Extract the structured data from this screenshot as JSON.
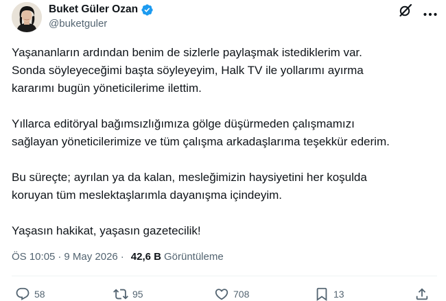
{
  "author": {
    "display_name": "Buket Güler Ozan",
    "handle": "@buketguler"
  },
  "icons": {
    "avatar": "avatar",
    "verified": "verified-badge-icon",
    "grok": "grok-icon",
    "more": "more-icon",
    "reply": "reply-icon",
    "retweet": "retweet-icon",
    "like": "like-icon",
    "bookmark": "bookmark-icon",
    "share": "share-icon"
  },
  "colors": {
    "verified": "#1d9bf0",
    "text": "#0f1419",
    "secondary": "#536471",
    "divider": "#eff3f4"
  },
  "tweet": {
    "paragraphs": [
      "Yaşananların ardından benim de sizlerle paylaşmak istediklerim var.\nSonda söyleyeceğimi başta söyleyeyim, Halk TV ile yollarımı ayırma\nkararımı bugün yöneticilerime ilettim.",
      "Yıllarca editöryal bağımsızlığımıza gölge düşürmeden çalışmamızı\nsağlayan yöneticilerimize ve tüm çalışma arkadaşlarıma teşekkür ederim.",
      "Bu süreçte; ayrılan ya da kalan, mesleğimizin haysiyetini her koşulda\nkoruyan tüm meslektaşlarımla dayanışma içindeyim.",
      "Yaşasın hakikat, yaşasın gazetecilik!"
    ]
  },
  "meta": {
    "time": "ÖS 10:05",
    "separator": "·",
    "date": "9 May 2026",
    "views_count": "42,6 B",
    "views_label": "Görüntüleme"
  },
  "actions": {
    "replies": "58",
    "retweets": "95",
    "likes": "708",
    "bookmarks": "13"
  }
}
